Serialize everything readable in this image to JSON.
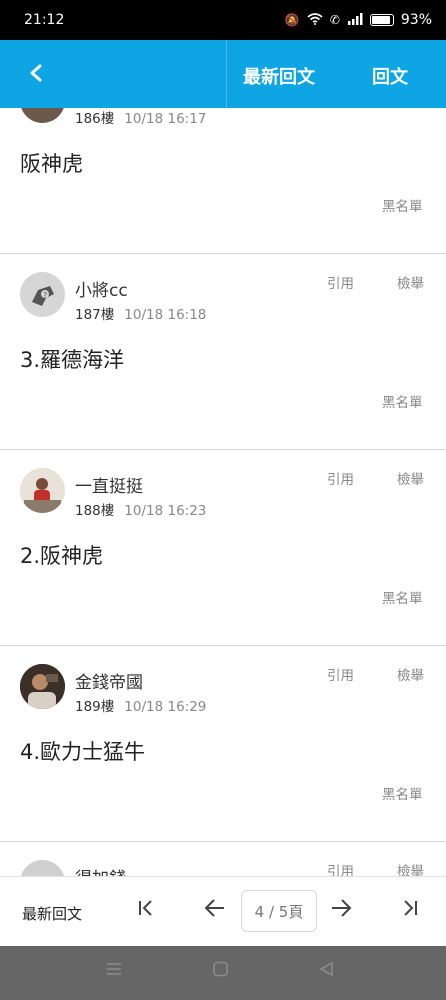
{
  "status_bar": {
    "time": "21:12",
    "battery": "93%"
  },
  "app_bar": {
    "latest_label": "最新回文",
    "reply_label": "回文"
  },
  "posts": [
    {
      "floor": "186樓",
      "date": "10/18 16:17",
      "content": "阪神虎",
      "blacklist": "黑名單"
    },
    {
      "author": "小將cc",
      "floor": "187樓",
      "date": "10/18 16:18",
      "quote": "引用",
      "report": "檢舉",
      "content": "3.羅德海洋",
      "blacklist": "黑名單"
    },
    {
      "author": "一直挺挺",
      "floor": "188樓",
      "date": "10/18 16:23",
      "quote": "引用",
      "report": "檢舉",
      "content": "2.阪神虎",
      "blacklist": "黑名單"
    },
    {
      "author": "金錢帝國",
      "floor": "189樓",
      "date": "10/18 16:29",
      "quote": "引用",
      "report": "檢舉",
      "content": "4.歐力士猛牛",
      "blacklist": "黑名單"
    },
    {
      "author": "得加錢",
      "quote": "引用",
      "report": "檢舉"
    }
  ],
  "toolbar": {
    "latest_label": "最新回文",
    "page_indicator": "4 / 5頁"
  },
  "icons": {
    "back": "chevron-left-icon",
    "first": "first-page-icon",
    "prev": "arrow-left-icon",
    "next": "arrow-right-icon",
    "last": "last-page-icon"
  },
  "colors": {
    "app_bar": "#0ea5e5",
    "status_bar": "#000000",
    "nav_bar": "#666666"
  }
}
